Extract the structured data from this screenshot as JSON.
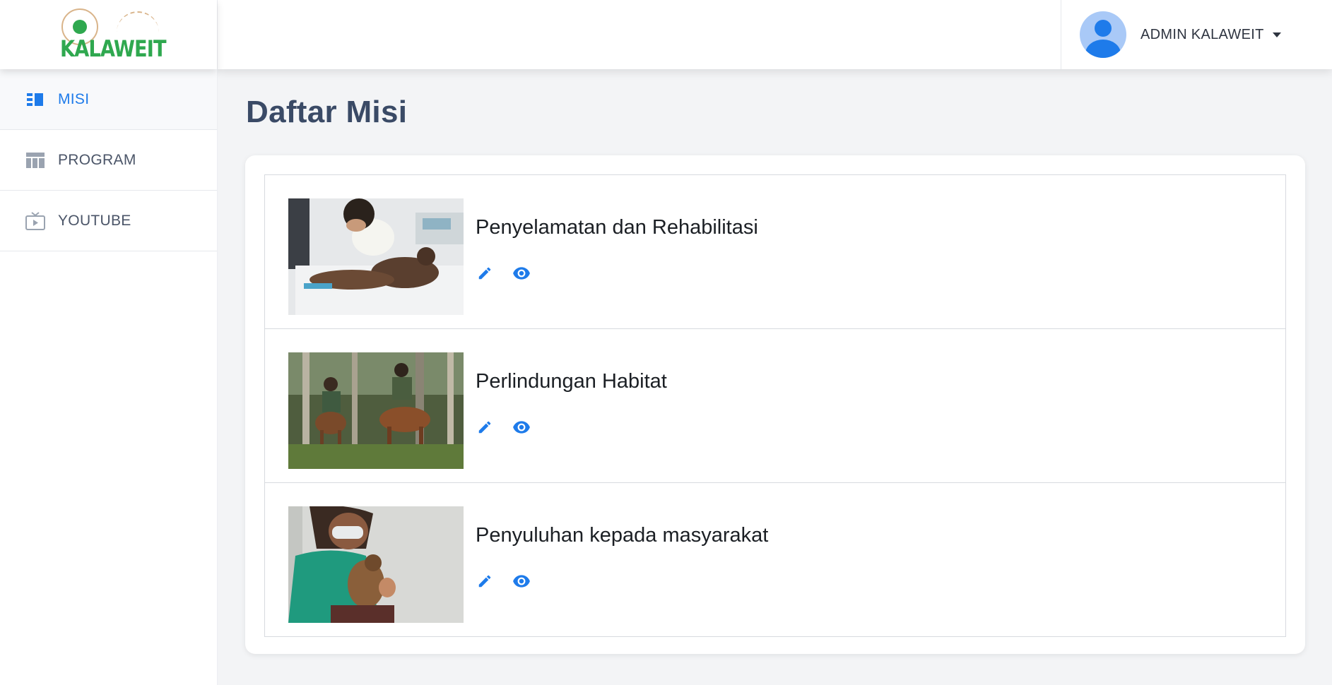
{
  "brand": {
    "logo_text": "KALAWEIT"
  },
  "sidebar": {
    "items": [
      {
        "label": "MISI",
        "icon": "list-columns-icon",
        "active": true
      },
      {
        "label": "PROGRAM",
        "icon": "table-layout-icon",
        "active": false
      },
      {
        "label": "YOUTUBE",
        "icon": "tv-play-icon",
        "active": false
      }
    ]
  },
  "header": {
    "user_name": "ADMIN KALAWEIT"
  },
  "main": {
    "title": "Daftar Misi",
    "missions": [
      {
        "title": "Penyelamatan dan Rehabilitasi",
        "image": "vet-treating-primate-photo"
      },
      {
        "title": "Perlindungan Habitat",
        "image": "rangers-on-horseback-forest-photo"
      },
      {
        "title": "Penyuluhan kepada masyarakat",
        "image": "caretaker-holding-gibbon-photo"
      }
    ]
  },
  "colors": {
    "accent": "#1e7bea",
    "title": "#3a4a66",
    "brand_green": "#2fa84f"
  }
}
